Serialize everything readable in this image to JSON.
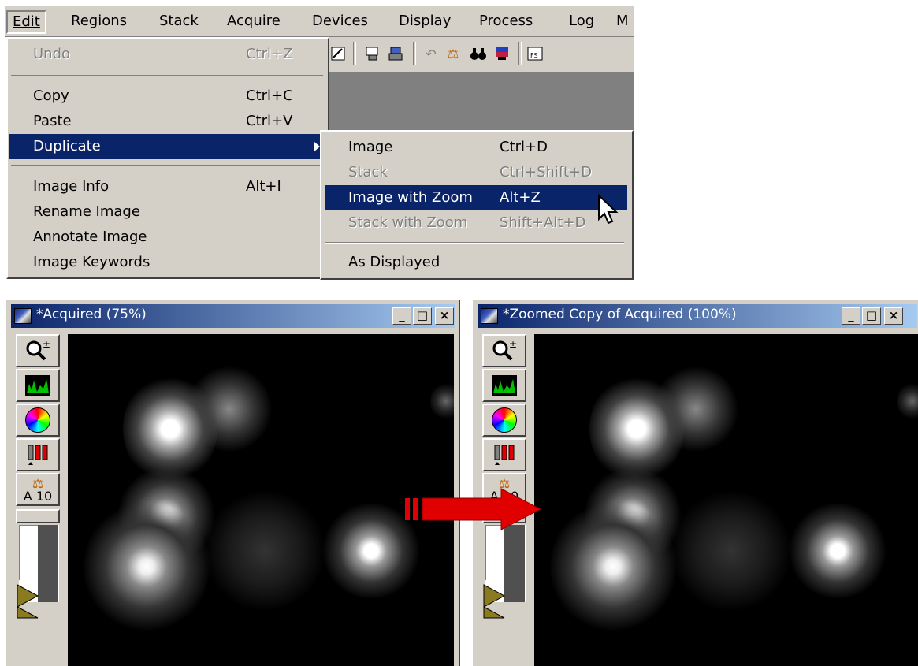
{
  "menubar": {
    "items": [
      {
        "label": "Edit",
        "active": true
      },
      {
        "label": "Regions"
      },
      {
        "label": "Stack"
      },
      {
        "label": "Acquire"
      },
      {
        "label": "Devices"
      },
      {
        "label": "Display"
      },
      {
        "label": "Process"
      },
      {
        "label": "Log"
      },
      {
        "label": "M"
      }
    ]
  },
  "edit_menu": {
    "undo": {
      "label": "Undo",
      "shortcut": "Ctrl+Z"
    },
    "copy": {
      "label": "Copy",
      "shortcut": "Ctrl+C"
    },
    "paste": {
      "label": "Paste",
      "shortcut": "Ctrl+V"
    },
    "duplicate": {
      "label": "Duplicate"
    },
    "image_info": {
      "label": "Image Info",
      "shortcut": "Alt+I"
    },
    "rename_image": {
      "label": "Rename Image"
    },
    "annotate_image": {
      "label": "Annotate Image"
    },
    "image_keywords": {
      "label": "Image Keywords"
    }
  },
  "duplicate_submenu": {
    "image": {
      "label": "Image",
      "shortcut": "Ctrl+D"
    },
    "stack": {
      "label": "Stack",
      "shortcut": "Ctrl+Shift+D"
    },
    "image_with_zoom": {
      "label": "Image with Zoom",
      "shortcut": "Alt+Z"
    },
    "stack_with_zoom": {
      "label": "Stack with Zoom",
      "shortcut": "Shift+Alt+D"
    },
    "as_displayed": {
      "label": "As Displayed"
    }
  },
  "window_left": {
    "title": "*Acquired (75%)"
  },
  "window_right": {
    "title": "*Zoomed Copy of Acquired (100%)"
  },
  "sidebar": {
    "scale_label": "A 10"
  },
  "caption_buttons": {
    "minimize": "_",
    "maximize": "□",
    "close": "×"
  },
  "colors": {
    "menu_highlight": "#0a246a",
    "arrow": "#e00000",
    "face": "#d4d0c8"
  }
}
